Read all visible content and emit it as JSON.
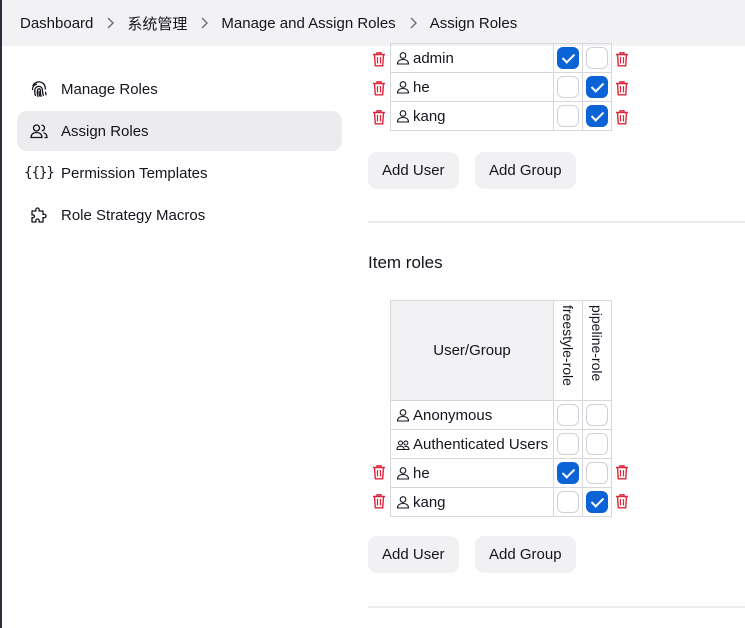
{
  "breadcrumb": {
    "items": [
      "Dashboard",
      "系统管理",
      "Manage and Assign Roles",
      "Assign Roles"
    ]
  },
  "sidebar": {
    "items": [
      {
        "label": "Manage Roles",
        "icon": "fingerprint-icon",
        "active": false
      },
      {
        "label": "Assign Roles",
        "icon": "people-icon",
        "active": true
      },
      {
        "label": "Permission Templates",
        "icon": "braces-icon",
        "active": false
      },
      {
        "label": "Role Strategy Macros",
        "icon": "puzzle-icon",
        "active": false
      }
    ]
  },
  "global_roles": {
    "rows": [
      {
        "name": "admin",
        "checks": [
          true,
          false
        ]
      },
      {
        "name": "he",
        "checks": [
          false,
          true
        ]
      },
      {
        "name": "kang",
        "checks": [
          false,
          true
        ]
      }
    ],
    "add_user_label": "Add User",
    "add_group_label": "Add Group"
  },
  "item_roles": {
    "title": "Item roles",
    "header_label": "User/Group",
    "columns": [
      "freestyle-role",
      "pipeline-role"
    ],
    "rows": [
      {
        "name": "Anonymous",
        "icon": "user-icon",
        "checks": [
          false,
          false
        ],
        "deletable": false
      },
      {
        "name": "Authenticated Users",
        "icon": "group-icon",
        "checks": [
          false,
          false
        ],
        "deletable": false
      },
      {
        "name": "he",
        "icon": "user-icon",
        "checks": [
          true,
          false
        ],
        "deletable": true
      },
      {
        "name": "kang",
        "icon": "user-icon",
        "checks": [
          false,
          true
        ],
        "deletable": true
      }
    ],
    "add_user_label": "Add User",
    "add_group_label": "Add Group"
  },
  "colors": {
    "accent": "#0b63d6",
    "danger": "#e0243a",
    "breadcrumb_bg": "#f2f2f4"
  }
}
